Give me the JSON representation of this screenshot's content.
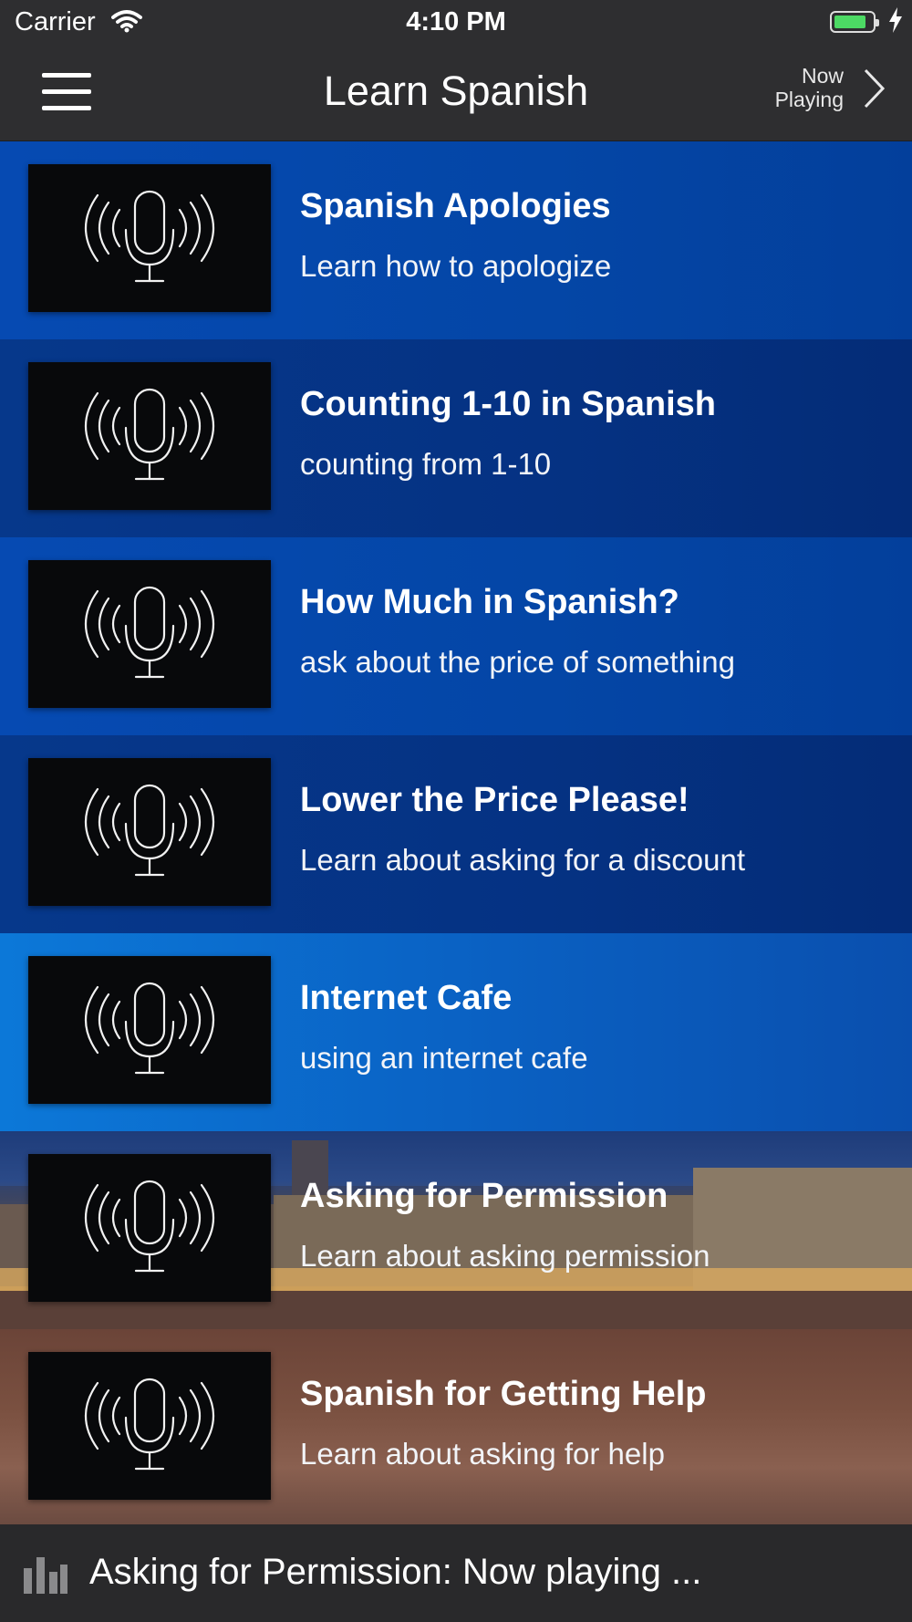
{
  "status_bar": {
    "carrier": "Carrier",
    "time": "4:10 PM",
    "battery_level": 0.85,
    "battery_color": "#4cd964"
  },
  "nav": {
    "menu_icon": "hamburger-menu-icon",
    "title": "Learn Spanish",
    "now_playing_line1": "Now",
    "now_playing_line2": "Playing",
    "now_playing_icon": "chevron-right-icon"
  },
  "lessons": [
    {
      "title": "Spanish Apologies",
      "subtitle": "Learn how to apologize",
      "icon": "podcast-microphone-icon"
    },
    {
      "title": "Counting 1-10 in Spanish",
      "subtitle": "counting from 1-10",
      "icon": "podcast-microphone-icon"
    },
    {
      "title": "How Much in Spanish?",
      "subtitle": "ask about the price of something",
      "icon": "podcast-microphone-icon"
    },
    {
      "title": "Lower the Price Please!",
      "subtitle": "Learn about asking for a discount",
      "icon": "podcast-microphone-icon"
    },
    {
      "title": "Internet Cafe",
      "subtitle": "using an internet cafe",
      "icon": "podcast-microphone-icon"
    },
    {
      "title": "Asking for Permission",
      "subtitle": "Learn about asking permission",
      "icon": "podcast-microphone-icon"
    },
    {
      "title": "Spanish for Getting Help",
      "subtitle": "Learn about asking for help",
      "icon": "podcast-microphone-icon"
    }
  ],
  "player": {
    "icon": "equalizer-icon",
    "text": "Asking for Permission: Now playing ..."
  },
  "colors": {
    "bar_background": "#2e2e30",
    "row_blue_light": "#064ab2",
    "row_blue_dark": "#06388b",
    "thumb_background": "#08090b"
  }
}
